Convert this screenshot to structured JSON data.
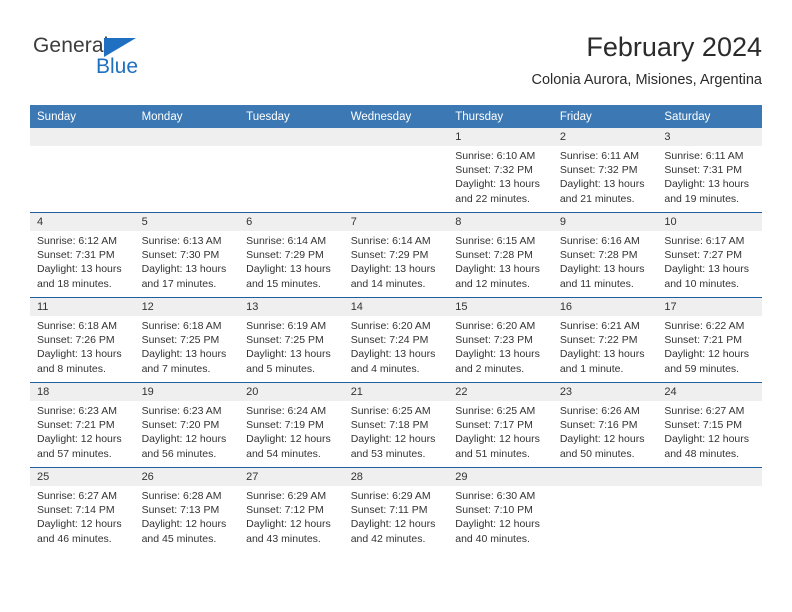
{
  "brand": {
    "name_part1": "General",
    "name_part2": "Blue",
    "triangle_color": "#1f70c1"
  },
  "header": {
    "title": "February 2024",
    "subtitle": "Colonia Aurora, Misiones, Argentina",
    "header_bg": "#3c78b4",
    "row_divider": "#1f5fa0",
    "daynum_band_bg": "#efefef"
  },
  "weekday_headers": [
    "Sunday",
    "Monday",
    "Tuesday",
    "Wednesday",
    "Thursday",
    "Friday",
    "Saturday"
  ],
  "weeks": [
    [
      {
        "day": "",
        "sunrise": "",
        "sunset": "",
        "daylight1": "",
        "daylight2": ""
      },
      {
        "day": "",
        "sunrise": "",
        "sunset": "",
        "daylight1": "",
        "daylight2": ""
      },
      {
        "day": "",
        "sunrise": "",
        "sunset": "",
        "daylight1": "",
        "daylight2": ""
      },
      {
        "day": "",
        "sunrise": "",
        "sunset": "",
        "daylight1": "",
        "daylight2": ""
      },
      {
        "day": "1",
        "sunrise": "Sunrise: 6:10 AM",
        "sunset": "Sunset: 7:32 PM",
        "daylight1": "Daylight: 13 hours",
        "daylight2": "and 22 minutes."
      },
      {
        "day": "2",
        "sunrise": "Sunrise: 6:11 AM",
        "sunset": "Sunset: 7:32 PM",
        "daylight1": "Daylight: 13 hours",
        "daylight2": "and 21 minutes."
      },
      {
        "day": "3",
        "sunrise": "Sunrise: 6:11 AM",
        "sunset": "Sunset: 7:31 PM",
        "daylight1": "Daylight: 13 hours",
        "daylight2": "and 19 minutes."
      }
    ],
    [
      {
        "day": "4",
        "sunrise": "Sunrise: 6:12 AM",
        "sunset": "Sunset: 7:31 PM",
        "daylight1": "Daylight: 13 hours",
        "daylight2": "and 18 minutes."
      },
      {
        "day": "5",
        "sunrise": "Sunrise: 6:13 AM",
        "sunset": "Sunset: 7:30 PM",
        "daylight1": "Daylight: 13 hours",
        "daylight2": "and 17 minutes."
      },
      {
        "day": "6",
        "sunrise": "Sunrise: 6:14 AM",
        "sunset": "Sunset: 7:29 PM",
        "daylight1": "Daylight: 13 hours",
        "daylight2": "and 15 minutes."
      },
      {
        "day": "7",
        "sunrise": "Sunrise: 6:14 AM",
        "sunset": "Sunset: 7:29 PM",
        "daylight1": "Daylight: 13 hours",
        "daylight2": "and 14 minutes."
      },
      {
        "day": "8",
        "sunrise": "Sunrise: 6:15 AM",
        "sunset": "Sunset: 7:28 PM",
        "daylight1": "Daylight: 13 hours",
        "daylight2": "and 12 minutes."
      },
      {
        "day": "9",
        "sunrise": "Sunrise: 6:16 AM",
        "sunset": "Sunset: 7:28 PM",
        "daylight1": "Daylight: 13 hours",
        "daylight2": "and 11 minutes."
      },
      {
        "day": "10",
        "sunrise": "Sunrise: 6:17 AM",
        "sunset": "Sunset: 7:27 PM",
        "daylight1": "Daylight: 13 hours",
        "daylight2": "and 10 minutes."
      }
    ],
    [
      {
        "day": "11",
        "sunrise": "Sunrise: 6:18 AM",
        "sunset": "Sunset: 7:26 PM",
        "daylight1": "Daylight: 13 hours",
        "daylight2": "and 8 minutes."
      },
      {
        "day": "12",
        "sunrise": "Sunrise: 6:18 AM",
        "sunset": "Sunset: 7:25 PM",
        "daylight1": "Daylight: 13 hours",
        "daylight2": "and 7 minutes."
      },
      {
        "day": "13",
        "sunrise": "Sunrise: 6:19 AM",
        "sunset": "Sunset: 7:25 PM",
        "daylight1": "Daylight: 13 hours",
        "daylight2": "and 5 minutes."
      },
      {
        "day": "14",
        "sunrise": "Sunrise: 6:20 AM",
        "sunset": "Sunset: 7:24 PM",
        "daylight1": "Daylight: 13 hours",
        "daylight2": "and 4 minutes."
      },
      {
        "day": "15",
        "sunrise": "Sunrise: 6:20 AM",
        "sunset": "Sunset: 7:23 PM",
        "daylight1": "Daylight: 13 hours",
        "daylight2": "and 2 minutes."
      },
      {
        "day": "16",
        "sunrise": "Sunrise: 6:21 AM",
        "sunset": "Sunset: 7:22 PM",
        "daylight1": "Daylight: 13 hours",
        "daylight2": "and 1 minute."
      },
      {
        "day": "17",
        "sunrise": "Sunrise: 6:22 AM",
        "sunset": "Sunset: 7:21 PM",
        "daylight1": "Daylight: 12 hours",
        "daylight2": "and 59 minutes."
      }
    ],
    [
      {
        "day": "18",
        "sunrise": "Sunrise: 6:23 AM",
        "sunset": "Sunset: 7:21 PM",
        "daylight1": "Daylight: 12 hours",
        "daylight2": "and 57 minutes."
      },
      {
        "day": "19",
        "sunrise": "Sunrise: 6:23 AM",
        "sunset": "Sunset: 7:20 PM",
        "daylight1": "Daylight: 12 hours",
        "daylight2": "and 56 minutes."
      },
      {
        "day": "20",
        "sunrise": "Sunrise: 6:24 AM",
        "sunset": "Sunset: 7:19 PM",
        "daylight1": "Daylight: 12 hours",
        "daylight2": "and 54 minutes."
      },
      {
        "day": "21",
        "sunrise": "Sunrise: 6:25 AM",
        "sunset": "Sunset: 7:18 PM",
        "daylight1": "Daylight: 12 hours",
        "daylight2": "and 53 minutes."
      },
      {
        "day": "22",
        "sunrise": "Sunrise: 6:25 AM",
        "sunset": "Sunset: 7:17 PM",
        "daylight1": "Daylight: 12 hours",
        "daylight2": "and 51 minutes."
      },
      {
        "day": "23",
        "sunrise": "Sunrise: 6:26 AM",
        "sunset": "Sunset: 7:16 PM",
        "daylight1": "Daylight: 12 hours",
        "daylight2": "and 50 minutes."
      },
      {
        "day": "24",
        "sunrise": "Sunrise: 6:27 AM",
        "sunset": "Sunset: 7:15 PM",
        "daylight1": "Daylight: 12 hours",
        "daylight2": "and 48 minutes."
      }
    ],
    [
      {
        "day": "25",
        "sunrise": "Sunrise: 6:27 AM",
        "sunset": "Sunset: 7:14 PM",
        "daylight1": "Daylight: 12 hours",
        "daylight2": "and 46 minutes."
      },
      {
        "day": "26",
        "sunrise": "Sunrise: 6:28 AM",
        "sunset": "Sunset: 7:13 PM",
        "daylight1": "Daylight: 12 hours",
        "daylight2": "and 45 minutes."
      },
      {
        "day": "27",
        "sunrise": "Sunrise: 6:29 AM",
        "sunset": "Sunset: 7:12 PM",
        "daylight1": "Daylight: 12 hours",
        "daylight2": "and 43 minutes."
      },
      {
        "day": "28",
        "sunrise": "Sunrise: 6:29 AM",
        "sunset": "Sunset: 7:11 PM",
        "daylight1": "Daylight: 12 hours",
        "daylight2": "and 42 minutes."
      },
      {
        "day": "29",
        "sunrise": "Sunrise: 6:30 AM",
        "sunset": "Sunset: 7:10 PM",
        "daylight1": "Daylight: 12 hours",
        "daylight2": "and 40 minutes."
      },
      {
        "day": "",
        "sunrise": "",
        "sunset": "",
        "daylight1": "",
        "daylight2": ""
      },
      {
        "day": "",
        "sunrise": "",
        "sunset": "",
        "daylight1": "",
        "daylight2": ""
      }
    ]
  ]
}
